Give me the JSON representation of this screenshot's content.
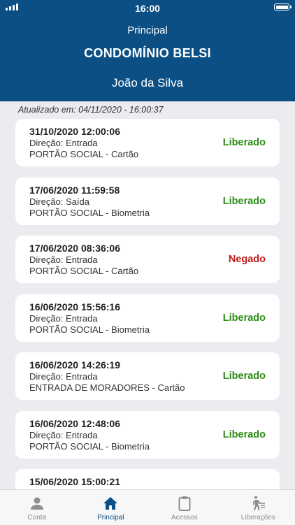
{
  "status_bar": {
    "time": "16:00"
  },
  "header": {
    "title": "Principal",
    "condominium": "CONDOMÍNIO BELSI",
    "user": "João da Silva"
  },
  "updated_label": "Atualizado em: 04/11/2020 - 16:00:37",
  "entries": [
    {
      "datetime": "31/10/2020 12:00:06",
      "direction": "Direção: Entrada",
      "gate": "PORTÃO SOCIAL - Cartão",
      "status": "Liberado"
    },
    {
      "datetime": "17/06/2020 11:59:58",
      "direction": "Direção: Saída",
      "gate": "PORTÃO SOCIAL - Biometria",
      "status": "Liberado"
    },
    {
      "datetime": "17/06/2020 08:36:06",
      "direction": "Direção: Entrada",
      "gate": "PORTÃO SOCIAL - Cartão",
      "status": "Negado"
    },
    {
      "datetime": "16/06/2020 15:56:16",
      "direction": "Direção: Entrada",
      "gate": "PORTÃO SOCIAL - Biometria",
      "status": "Liberado"
    },
    {
      "datetime": "16/06/2020 14:26:19",
      "direction": "Direção: Entrada",
      "gate": "ENTRADA DE MORADORES - Cartão",
      "status": "Liberado"
    },
    {
      "datetime": "16/06/2020 12:48:06",
      "direction": "Direção: Entrada",
      "gate": "PORTÃO SOCIAL - Biometria",
      "status": "Liberado"
    },
    {
      "datetime": "15/06/2020 15:00:21",
      "direction": "",
      "gate": "",
      "status": ""
    }
  ],
  "tabs": [
    {
      "label": "Conta",
      "icon": "person-icon"
    },
    {
      "label": "Principal",
      "icon": "home-icon"
    },
    {
      "label": "Acessos",
      "icon": "clipboard-icon"
    },
    {
      "label": "Liberações",
      "icon": "walk-permission-icon"
    }
  ],
  "colors": {
    "header": "#0b4f84",
    "granted": "#2e8b17",
    "denied": "#c21a1a"
  }
}
